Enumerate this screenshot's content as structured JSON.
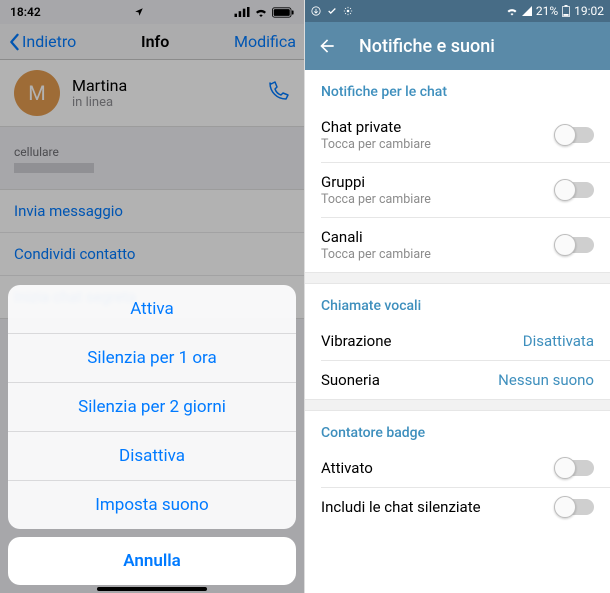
{
  "left": {
    "statusbar": {
      "time": "18:42"
    },
    "navbar": {
      "back": "Indietro",
      "title": "Info",
      "edit": "Modifica"
    },
    "contact": {
      "initial": "M",
      "name": "Martina",
      "status": "in linea"
    },
    "phone_label": "cellulare",
    "actions": {
      "send_message": "Invia messaggio",
      "share_contact": "Condividi contatto",
      "secret_chat": "Inizia chat segreta"
    },
    "actionsheet": {
      "enable": "Attiva",
      "mute_1h": "Silenzia per 1 ora",
      "mute_2d": "Silenzia per 2 giorni",
      "disable": "Disattiva",
      "set_sound": "Imposta suono",
      "cancel": "Annulla"
    }
  },
  "right": {
    "statusbar": {
      "battery": "21%",
      "time": "19:02"
    },
    "appbar": {
      "title": "Notifiche e suoni"
    },
    "sections": {
      "chat_notifications": {
        "header": "Notifiche per le chat",
        "private": {
          "title": "Chat private",
          "subtitle": "Tocca per cambiare"
        },
        "groups": {
          "title": "Gruppi",
          "subtitle": "Tocca per cambiare"
        },
        "channels": {
          "title": "Canali",
          "subtitle": "Tocca per cambiare"
        }
      },
      "calls": {
        "header": "Chiamate vocali",
        "vibration": {
          "title": "Vibrazione",
          "value": "Disattivata"
        },
        "ringtone": {
          "title": "Suoneria",
          "value": "Nessun suono"
        }
      },
      "badge": {
        "header": "Contatore badge",
        "enabled": {
          "title": "Attivato"
        },
        "include_muted": {
          "title": "Includi le chat silenziate"
        }
      }
    }
  }
}
